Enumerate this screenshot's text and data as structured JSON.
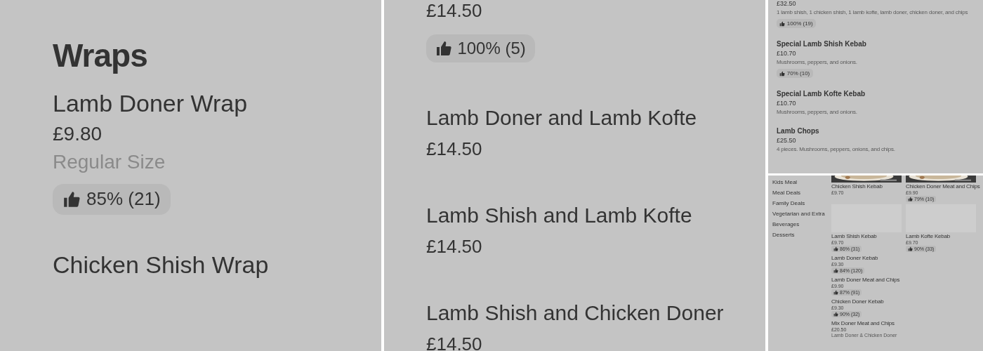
{
  "panels": [
    {
      "kind": "large",
      "heading": "Wraps",
      "items": [
        {
          "name": "Lamb Doner Wrap",
          "price": "£9.80",
          "description": "Regular Size",
          "rating": "85% (21)"
        },
        {
          "name": "Chicken Shish Wrap"
        }
      ]
    },
    {
      "kind": "medium",
      "items": [
        {
          "price": "£14.50",
          "rating": "100% (5)"
        },
        {
          "name": "Lamb Doner and Lamb Kofte",
          "price": "£14.50"
        },
        {
          "name": "Lamb Shish and Lamb Kofte",
          "price": "£14.50"
        },
        {
          "name": "Lamb Shish and Chicken Doner",
          "price": "£14.50"
        }
      ]
    },
    {
      "kind": "small",
      "items": [
        {
          "price": "£32.50",
          "description": "1 lamb shish, 1 chicken shish, 1 lamb kofte, lamb doner, chicken doner, and chips",
          "rating": "100% (19)"
        },
        {
          "name": "Special Lamb Shish Kebab",
          "price": "£10.70",
          "description": "Mushrooms, peppers, and onions.",
          "rating": "70% (10)"
        },
        {
          "name": "Special Lamb Kofte Kebab",
          "price": "£10.70",
          "description": "Mushrooms, peppers, and onions."
        },
        {
          "name": "Lamb Chops",
          "price": "£25.50",
          "description": "4 pieces. Mushrooms, peppers, onions, and chips."
        }
      ]
    },
    {
      "kind": "page",
      "categories": [
        "Kids Meal",
        "Meal Deals",
        "Family Deals",
        "Vegetarian and Extra",
        "Beverages",
        "Desserts"
      ],
      "cards": [
        {
          "kind": "picture",
          "name": "Chicken Shish Kebab",
          "price": "£9.70"
        },
        {
          "kind": "picture",
          "name": "Chicken Doner Meat and Chips",
          "price": "£9.90",
          "rating": "79% (10)"
        },
        {
          "name": "Lamb Shish Kebab",
          "price": "£9.70",
          "rating": "86% (31)"
        },
        {
          "name": "Lamb Kofte Kebab",
          "price": "£9.70",
          "rating": "90% (33)"
        }
      ],
      "items": [
        {
          "name": "Lamb Doner Kebab",
          "price": "£9.30",
          "rating": "84% (120)"
        },
        {
          "name": "Lamb Doner Meat and Chips",
          "price": "£9.90",
          "rating": "87% (91)"
        },
        {
          "name": "Chicken Doner Kebab",
          "price": "£9.30",
          "rating": "90% (32)"
        },
        {
          "name": "Mix Doner Meat and Chips",
          "price": "£20.50",
          "description": "Lamb Doner & Chicken Doner"
        }
      ]
    }
  ]
}
